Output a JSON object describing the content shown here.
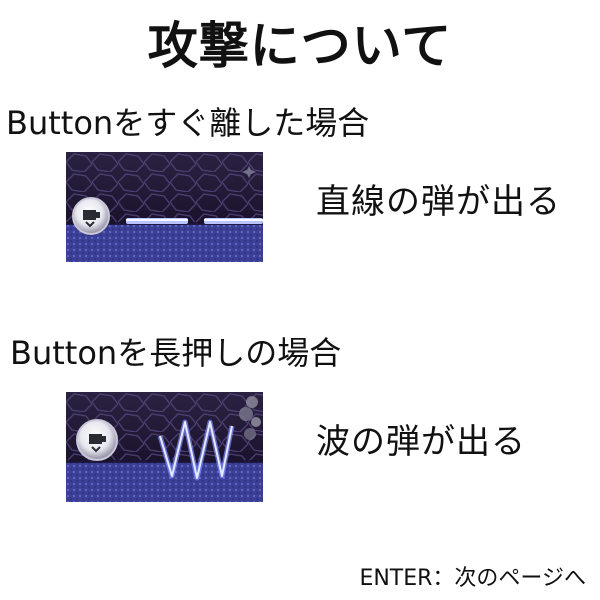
{
  "title": "攻撃について",
  "sections": [
    {
      "heading": "Buttonをすぐ離した場合",
      "result": "直線の弾が出る",
      "screenshot_icon": "straight-shot-scene"
    },
    {
      "heading": "Buttonを長押しの場合",
      "result": "波の弾が出る",
      "screenshot_icon": "wave-shot-scene"
    }
  ],
  "footer": {
    "hint": "ENTER：次のページへ"
  },
  "colors": {
    "background": "#ffffff",
    "text": "#111111",
    "scene_floor": "#3b3f96",
    "scene_bg": "#22183a",
    "beam": "#b9c3ff"
  }
}
